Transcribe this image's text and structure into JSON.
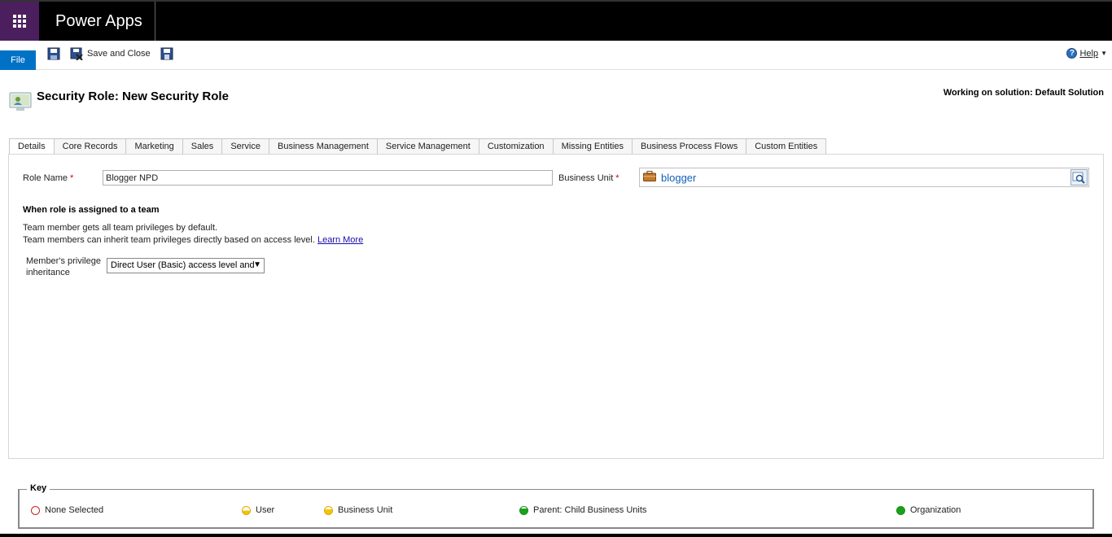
{
  "app": {
    "name": "Power Apps"
  },
  "ribbon": {
    "file_label": "File",
    "save_close_label": "Save and Close",
    "help_label": "Help"
  },
  "header": {
    "title": "Security Role: New Security Role",
    "solution": "Working on solution: Default Solution"
  },
  "tabs": [
    {
      "label": "Details"
    },
    {
      "label": "Core Records"
    },
    {
      "label": "Marketing"
    },
    {
      "label": "Sales"
    },
    {
      "label": "Service"
    },
    {
      "label": "Business Management"
    },
    {
      "label": "Service Management"
    },
    {
      "label": "Customization"
    },
    {
      "label": "Missing Entities"
    },
    {
      "label": "Business Process Flows"
    },
    {
      "label": "Custom Entities"
    }
  ],
  "form": {
    "role_name_label": "Role Name",
    "role_name_value": "Blogger NPD",
    "business_unit_label": "Business Unit",
    "business_unit_value": "blogger",
    "required_mark": "*",
    "team_section_title": "When role is assigned to a team",
    "info_line1": "Team member gets all team privileges by default.",
    "info_line2": "Team members can inherit team privileges directly based on access level.",
    "learn_more": "Learn More",
    "inherit_label": "Member's privilege inheritance",
    "inherit_value": "Direct User (Basic) access level and"
  },
  "key": {
    "title": "Key",
    "items": [
      {
        "label": "None Selected"
      },
      {
        "label": "User"
      },
      {
        "label": "Business Unit"
      },
      {
        "label": "Parent: Child Business Units"
      },
      {
        "label": "Organization"
      }
    ]
  }
}
